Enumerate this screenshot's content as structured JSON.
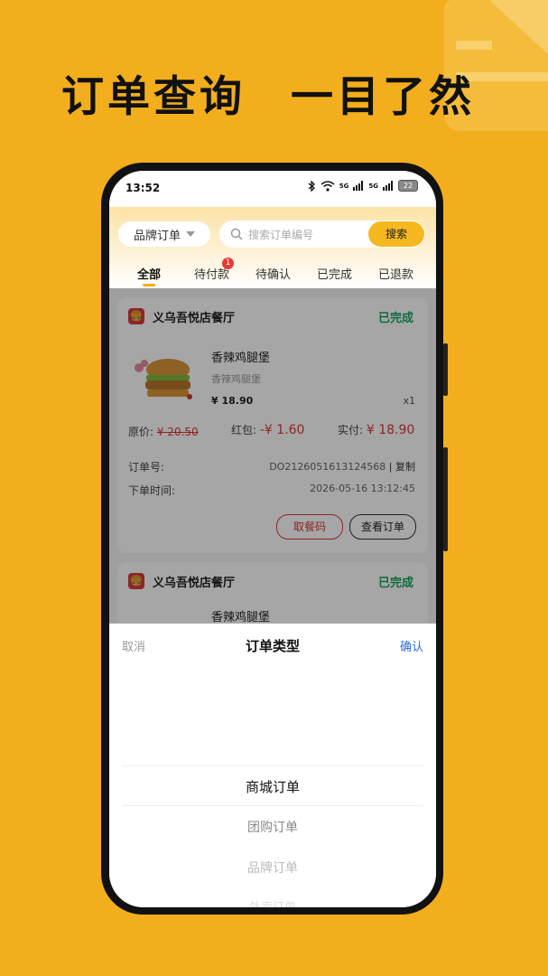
{
  "headline": {
    "left": "订单查询",
    "right": "一目了然"
  },
  "statusbar": {
    "time": "13:52",
    "network_1": "5G",
    "network_2": "5G",
    "battery": "22"
  },
  "topbar": {
    "brand_select": "品牌订单",
    "search_placeholder": "搜索订单编号",
    "search_button": "搜索"
  },
  "tabs": [
    {
      "label": "全部",
      "active": true
    },
    {
      "label": "待付款",
      "badge": "1"
    },
    {
      "label": "待确认"
    },
    {
      "label": "已完成"
    },
    {
      "label": "已退款"
    }
  ],
  "orders": [
    {
      "store": "义乌吾悦店餐厅",
      "status": "已完成",
      "product_name": "香辣鸡腿堡",
      "product_sub": "香辣鸡腿堡",
      "price": "¥ 18.90",
      "qty": "x1",
      "original_label": "原价:",
      "original_value": "¥ 20.50",
      "redpacket_label": "红包:",
      "redpacket_value": "-¥ 1.60",
      "paid_label": "实付:",
      "paid_value": "¥ 18.90",
      "order_no_label": "订单号:",
      "order_no_value": "DO2126051613124568",
      "copy_label": "| 复制",
      "time_label": "下单时间:",
      "time_value": "2026-05-16 13:12:45",
      "btn_pickup": "取餐码",
      "btn_view": "查看订单"
    },
    {
      "store": "义乌吾悦店餐厅",
      "status": "已完成",
      "product_name": "香辣鸡腿堡"
    }
  ],
  "sheet": {
    "cancel": "取消",
    "title": "订单类型",
    "confirm": "确认",
    "options": [
      "商城订单",
      "团购订单",
      "品牌订单",
      "外卖订单"
    ]
  },
  "colors": {
    "background": "#F2AE1C",
    "accent": "#F6B820",
    "complete": "#19A563",
    "price_red": "#D73A3A"
  }
}
